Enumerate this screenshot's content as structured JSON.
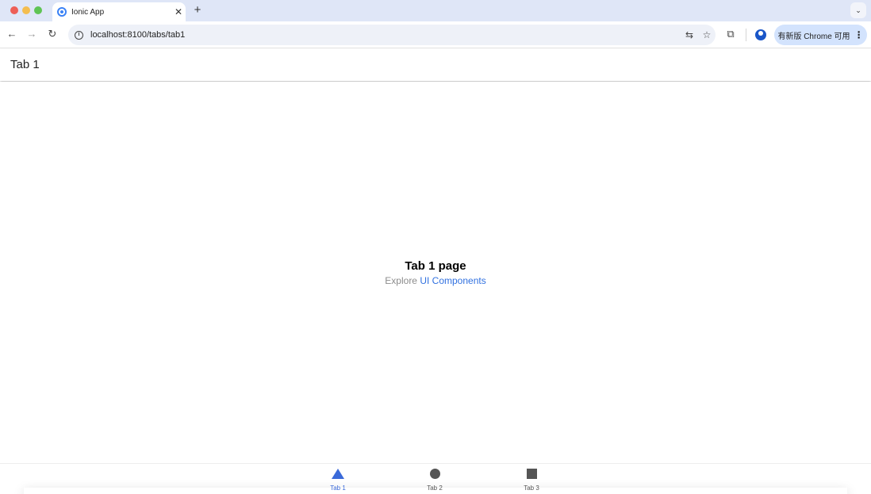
{
  "browser": {
    "tab_title": "Ionic App",
    "tab_close": "✕",
    "new_tab": "+",
    "tabs_menu": "⌄",
    "url": "localhost:8100/tabs/tab1",
    "update_label": "有新版 Chrome 可用",
    "update_menu": "⋮",
    "nav": {
      "back": "←",
      "forward": "→",
      "reload": "↻"
    },
    "icons": {
      "translate": "⇆",
      "bookmark": "☆",
      "extensions": "⧉"
    }
  },
  "app": {
    "header_title": "Tab 1",
    "page_heading": "Tab 1 page",
    "explore_prefix": "Explore",
    "explore_link": "UI Components",
    "active_color": "#3b6ad9",
    "tabs": [
      {
        "label": "Tab 1",
        "icon": "triangle-icon",
        "active": true
      },
      {
        "label": "Tab 2",
        "icon": "ellipse-icon",
        "active": false
      },
      {
        "label": "Tab 3",
        "icon": "square-icon",
        "active": false
      }
    ]
  }
}
